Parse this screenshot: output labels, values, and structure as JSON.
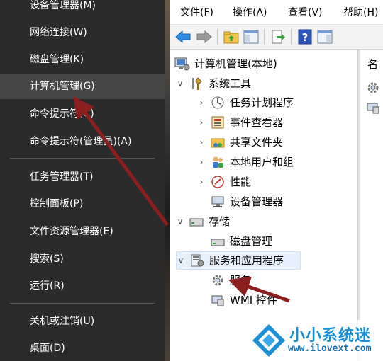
{
  "winx_menu": {
    "items": [
      {
        "label": "设备管理器(M)"
      },
      {
        "label": "网络连接(W)"
      },
      {
        "label": "磁盘管理(K)"
      },
      {
        "label": "计算机管理(G)"
      },
      {
        "label": "命令提示符(C)"
      },
      {
        "label": "命令提示符(管理员)(A)"
      },
      {
        "label": "任务管理器(T)"
      },
      {
        "label": "控制面板(P)"
      },
      {
        "label": "文件资源管理器(E)"
      },
      {
        "label": "搜索(S)"
      },
      {
        "label": "运行(R)"
      },
      {
        "label": "关机或注销(U)"
      },
      {
        "label": "桌面(D)"
      }
    ],
    "selected": "计算机管理(G)"
  },
  "mmc": {
    "menus": [
      "文件(F)",
      "操作(A)",
      "查看(V)",
      "帮助(H)"
    ],
    "toolbar_icons": [
      "back-arrow-icon",
      "forward-arrow-icon",
      "up-folder-icon",
      "show-hide-tree-icon",
      "export-list-icon",
      "help-icon",
      "properties-pane-icon"
    ],
    "tree": {
      "root": "计算机管理(本地)",
      "system_tools": "系统工具",
      "task_scheduler": "任务计划程序",
      "event_viewer": "事件查看器",
      "shared_folders": "共享文件夹",
      "local_users": "本地用户和组",
      "performance": "性能",
      "device_manager": "设备管理器",
      "storage": "存储",
      "disk_management": "磁盘管理",
      "services_apps": "服务和应用程序",
      "services": "服务",
      "wmi_control": "WMI 控件"
    },
    "right_pane_header": "名",
    "selected_node": "服务和应用程序"
  },
  "watermark": {
    "name": "小小系统迷",
    "url": "www.ilovext.com"
  },
  "colors": {
    "menu_bg": "#2b2b2b",
    "menu_selected": "#474747",
    "annotation_arrow": "#8b1e1e",
    "watermark_blue": "#1b8fd6"
  }
}
